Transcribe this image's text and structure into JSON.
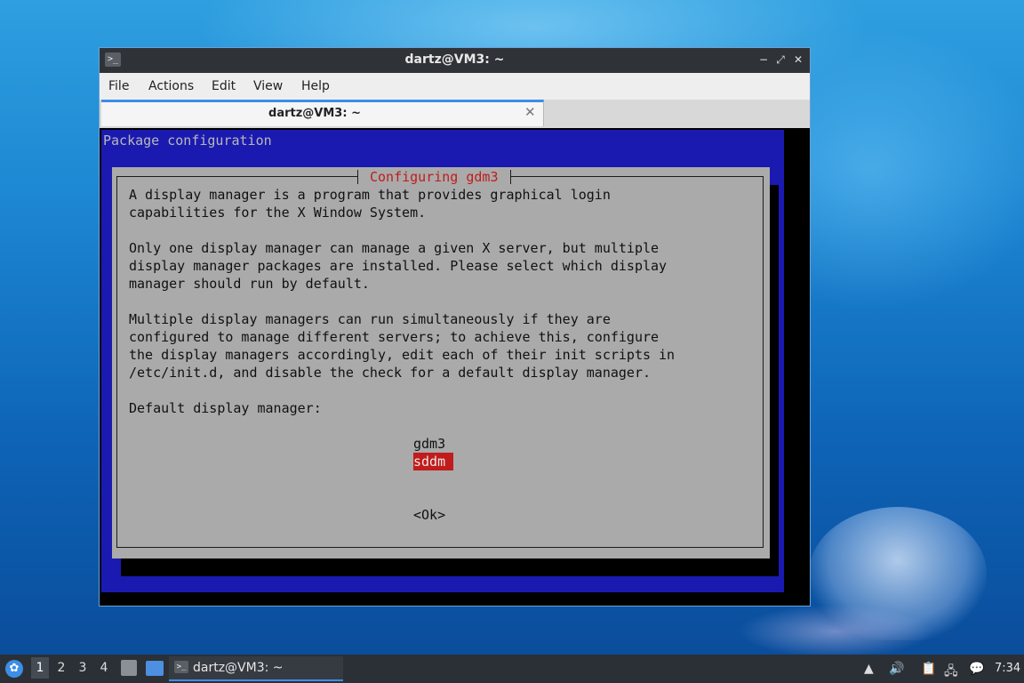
{
  "window": {
    "title": "dartz@VM3: ~",
    "menu": [
      "File",
      "Actions",
      "Edit",
      "View",
      "Help"
    ],
    "tab_label": "dartz@VM3: ~"
  },
  "terminal": {
    "header": "Package configuration",
    "dialog_title": "Configuring gdm3",
    "lines": [
      "A display manager is a program that provides graphical login",
      "capabilities for the X Window System.",
      "",
      "Only one display manager can manage a given X server, but multiple",
      "display manager packages are installed. Please select which display",
      "manager should run by default.",
      "",
      "Multiple display managers can run simultaneously if they are",
      "configured to manage different servers; to achieve this, configure",
      "the display managers accordingly, edit each of their init scripts in",
      "/etc/init.d, and disable the check for a default display manager.",
      "",
      "Default display manager:"
    ],
    "options": [
      "gdm3",
      "sddm"
    ],
    "selected_option": "sddm",
    "ok_button": "<Ok>"
  },
  "taskbar": {
    "workspaces": [
      "1",
      "2",
      "3",
      "4"
    ],
    "active_workspace": "1",
    "task_label": "dartz@VM3: ~",
    "clock": "7:34"
  }
}
